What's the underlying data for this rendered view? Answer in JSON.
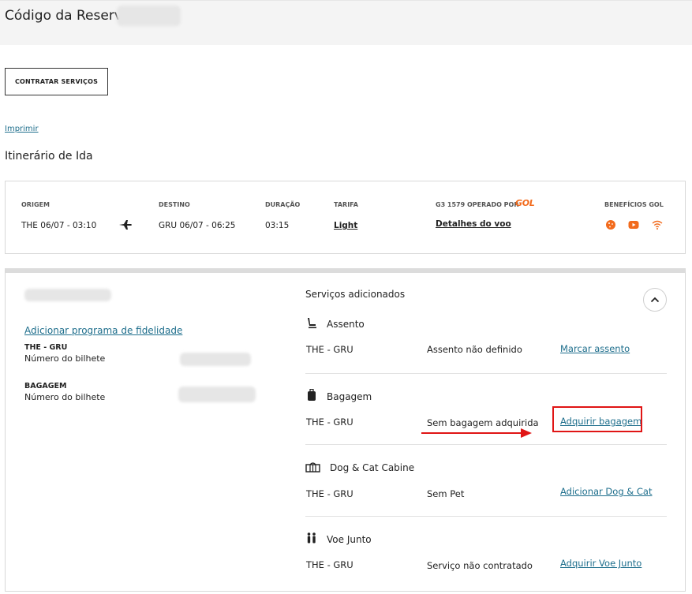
{
  "header": {
    "title": "Código da Reserva"
  },
  "actions": {
    "contratar_label": "CONTRATAR SERVIÇOS",
    "imprimir_label": "Imprimir"
  },
  "itinerary": {
    "title": "Itinerário de Ida",
    "origem_label": "ORIGEM",
    "origem_value": "THE 06/07  -  03:10",
    "destino_label": "DESTINO",
    "destino_value": "GRU 06/07  -  06:25",
    "duracao_label": "DURAÇÃO",
    "duracao_value": "03:15",
    "tarifa_label": "TARIFA",
    "tarifa_value": "Light",
    "voo_label": "G3 1579 OPERADO POR",
    "airline_logo": "GOL",
    "voo_link": "Detalhes do voo",
    "beneficios_label": "BENEFÍCIOS GOL",
    "beneficios_icons": [
      "cookie-icon",
      "youtube-icon",
      "wifi-icon"
    ],
    "accent_color": "#f26b1d"
  },
  "passenger": {
    "fidelidade_link": "Adicionar programa de fidelidade",
    "route_label": "THE - GRU",
    "bilhete_label_1": "Número do bilhete",
    "bagagem_label": "BAGAGEM",
    "bilhete_label_2": "Número do bilhete"
  },
  "services": {
    "title": "Serviços adicionados",
    "items": [
      {
        "icon": "seat-icon",
        "name": "Assento",
        "route": "THE - GRU",
        "status": "Assento não definido",
        "action": "Marcar assento"
      },
      {
        "icon": "luggage-icon",
        "name": "Bagagem",
        "route": "THE - GRU",
        "status": "Sem bagagem adquirida",
        "action": "Adquirir bagagem"
      },
      {
        "icon": "pet-carrier-icon",
        "name": "Dog & Cat Cabine",
        "route": "THE - GRU",
        "status": "Sem Pet",
        "action": "Adicionar Dog & Cat"
      },
      {
        "icon": "family-icon",
        "name": "Voe Junto",
        "route": "THE - GRU",
        "status": "Serviço não contratado",
        "action": "Adquirir Voe Junto"
      }
    ]
  },
  "annotation": {
    "color": "#e01515"
  }
}
